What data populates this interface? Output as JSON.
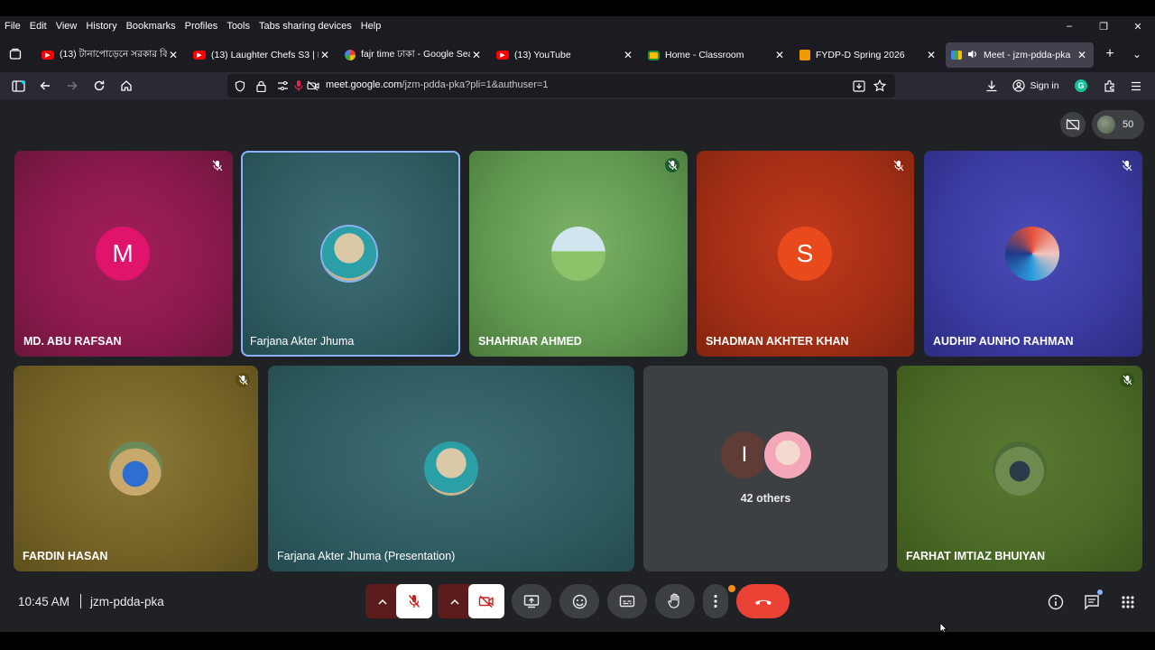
{
  "menu": [
    "File",
    "Edit",
    "View",
    "History",
    "Bookmarks",
    "Profiles",
    "Tools",
    "Tabs sharing devices",
    "Help"
  ],
  "window_controls": {
    "minimize": "–",
    "restore": "❐",
    "close": "✕"
  },
  "tabs": [
    {
      "title": "(13) টানাপোড়েনে সরকার কি",
      "favicon": "youtube-icon",
      "close": "✕"
    },
    {
      "title": "(13) Laughter Chefs S3 | Ful",
      "favicon": "youtube-icon",
      "close": "✕"
    },
    {
      "title": "fajr time ঢাকা - Google Sea",
      "favicon": "google-icon",
      "close": "✕"
    },
    {
      "title": "(13) YouTube",
      "favicon": "youtube-icon",
      "close": "✕"
    },
    {
      "title": "Home - Classroom",
      "favicon": "classroom-icon",
      "close": "✕"
    },
    {
      "title": "FYDP-D Spring 2026",
      "favicon": "classroom-icon",
      "close": "✕"
    },
    {
      "title": "Meet - jzm-pdda-pka",
      "favicon": "meet-icon",
      "close": "✕"
    }
  ],
  "new_tab": "+",
  "tab_list": "⌄",
  "nav": {
    "url_domain": "meet.google.com",
    "url_path": "/jzm-pdda-pka?pli=1&authuser=1",
    "sign_in": "Sign in"
  },
  "meet": {
    "participant_count": "50",
    "participants": [
      {
        "name": "MD. ABU RAFSAN",
        "initial": "M",
        "muted": true
      },
      {
        "name": "Farjana Akter Jhuma",
        "initial": "",
        "muted": false
      },
      {
        "name": "SHAHRIAR AHMED",
        "initial": "",
        "muted": true
      },
      {
        "name": "SHADMAN AKHTER KHAN",
        "initial": "S",
        "muted": true
      },
      {
        "name": "AUDHIP AUNHO RAHMAN",
        "initial": "",
        "muted": true
      },
      {
        "name": "FARDIN HASAN",
        "initial": "",
        "muted": true
      },
      {
        "name": "Farjana Akter Jhuma (Presentation)",
        "initial": "",
        "muted": false
      },
      {
        "name": "FARHAT IMTIAZ BHUIYAN",
        "initial": "",
        "muted": true
      }
    ],
    "others": {
      "label": "42 others",
      "initial": "I"
    },
    "time": "10:45 AM",
    "meeting_code": "jzm-pdda-pka"
  },
  "colors": {
    "accent": "#8ab4f8",
    "leave": "#ea4335",
    "muted_ctrl": "#f28b82",
    "ctrl_bg": "#3c4043"
  }
}
